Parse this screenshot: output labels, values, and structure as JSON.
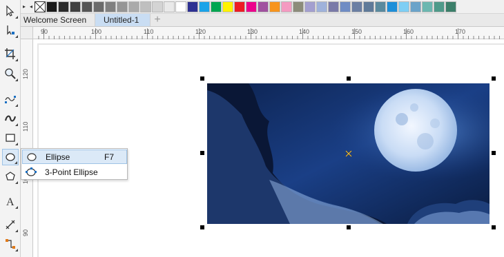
{
  "palette": {
    "colors": [
      "#1a1a1a",
      "#2b2b2b",
      "#404040",
      "#555555",
      "#6b6b6b",
      "#808080",
      "#959595",
      "#aaaaaa",
      "#bfbfbf",
      "#d4d4d4",
      "#e9e9e9",
      "#ffffff",
      "#2e3192",
      "#1aa3e8",
      "#00a651",
      "#fff200",
      "#ed1c24",
      "#ec008c",
      "#a0519f",
      "#f7941d",
      "#f49ac1",
      "#8c8c7a",
      "#a39fcf",
      "#9fb2db",
      "#7a7aa8",
      "#6f8cc4",
      "#6b7fa3",
      "#5f7a99",
      "#5a8a9e",
      "#1e8fd9",
      "#7ecef4",
      "#6aa3c9",
      "#6cb7b0",
      "#4f9a8a",
      "#3c7f6a"
    ]
  },
  "tabs": {
    "welcome": "Welcome Screen",
    "untitled": "Untitled-1",
    "add": "+"
  },
  "ruler": {
    "h_labels": [
      "90",
      "100",
      "110",
      "120",
      "130",
      "140",
      "150",
      "160",
      "170"
    ],
    "v_labels": [
      "120",
      "110",
      "100",
      "90"
    ]
  },
  "flyout": {
    "ellipse_label": "Ellipse",
    "ellipse_shortcut": "F7",
    "three_point_label": "3-Point Ellipse"
  },
  "icons": {
    "pick": "pick-tool-icon",
    "shape": "shape-tool-icon",
    "crop": "crop-tool-icon",
    "zoom": "zoom-tool-icon",
    "freehand": "freehand-tool-icon",
    "artistic": "artistic-media-icon",
    "rectangle": "rectangle-tool-icon",
    "ellipse": "ellipse-tool-icon",
    "polygon": "polygon-tool-icon",
    "text": "text-tool-icon",
    "dimension": "dimension-tool-icon",
    "connector": "connector-tool-icon"
  }
}
